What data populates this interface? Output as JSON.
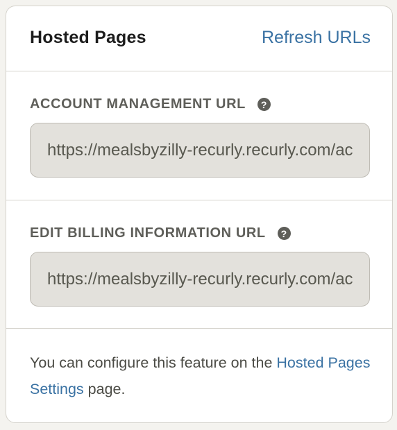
{
  "header": {
    "title": "Hosted Pages",
    "refresh_link": "Refresh URLs"
  },
  "fields": [
    {
      "label": "ACCOUNT MANAGEMENT URL",
      "value": "https://mealsbyzilly-recurly.recurly.com/account"
    },
    {
      "label": "EDIT BILLING INFORMATION URL",
      "value": "https://mealsbyzilly-recurly.recurly.com/account/billing_info/edit"
    }
  ],
  "footer": {
    "text_before": "You can configure this feature on the ",
    "link": "Hosted Pages Settings",
    "text_after": " page."
  },
  "icons": {
    "help": "question-mark-circle-icon"
  },
  "colors": {
    "link": "#3a72a3",
    "input_bg": "#e3e1dc",
    "label": "#5e5e59"
  }
}
